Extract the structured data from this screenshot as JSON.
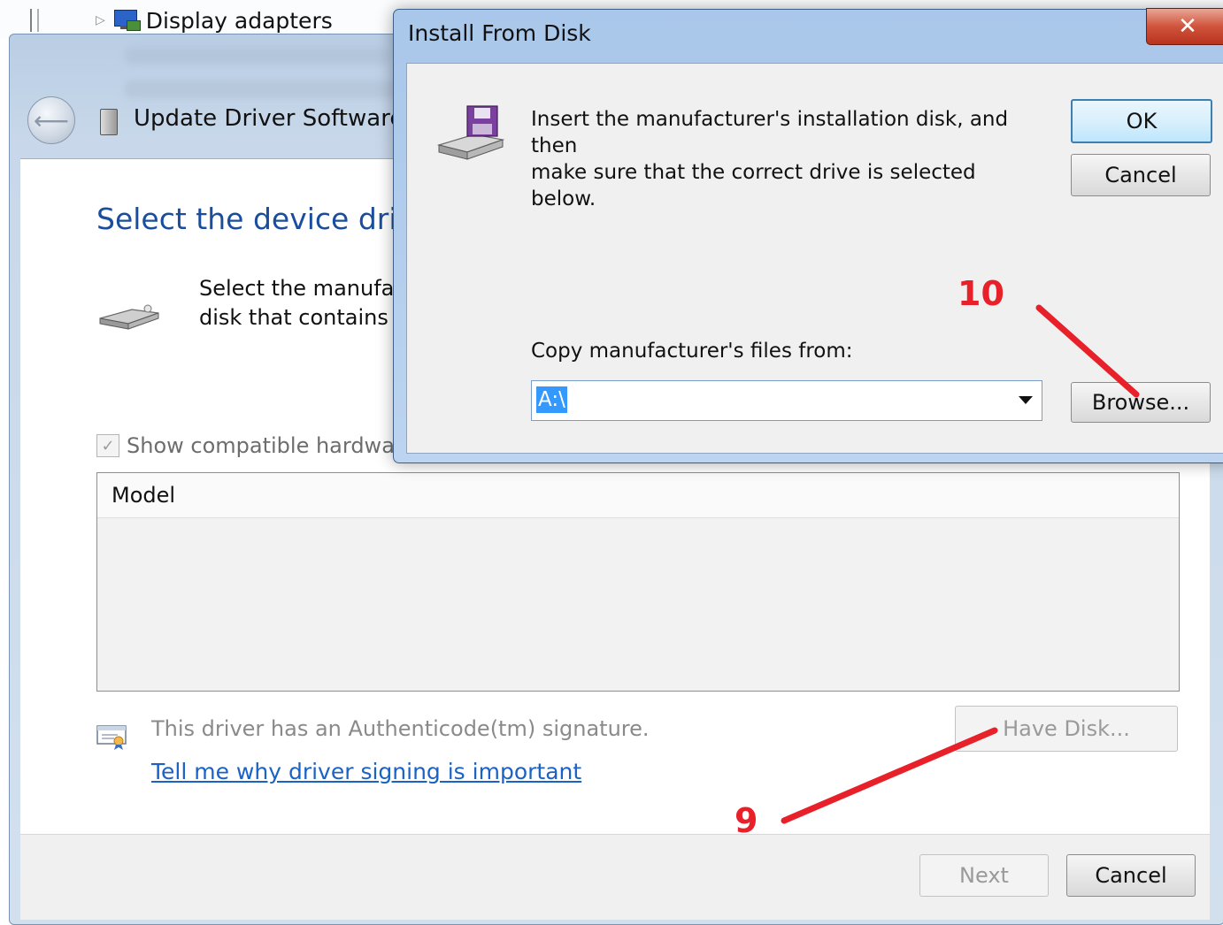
{
  "device_manager": {
    "tree_item_label": "Display adapters",
    "tree_arrow": "▷"
  },
  "wizard": {
    "title": "Update Driver Software -",
    "heading": "Select the device drive",
    "intro_line1": "Select the manufac",
    "intro_line2": "disk that contains t",
    "compatible_label": "Show compatible hardwa",
    "compatible_checked": true,
    "model_column": "Model",
    "signature_text": "This driver has an Authenticode(tm) signature.",
    "signing_link": "Tell me why driver signing is important",
    "have_disk_label": "Have Disk...",
    "next_label": "Next",
    "cancel_label": "Cancel"
  },
  "install_dialog": {
    "title": "Install From Disk",
    "close_glyph": "✕",
    "message_line1": "Insert the manufacturer's installation disk, and then",
    "message_line2": "make sure that the correct drive is selected below.",
    "ok_label": "OK",
    "cancel_label": "Cancel",
    "copy_label": "Copy manufacturer's files from:",
    "path_value": "A:\\",
    "browse_label": "Browse..."
  },
  "annotations": {
    "step_browse": "10",
    "step_have_disk": "9",
    "color": "#e8202a"
  }
}
